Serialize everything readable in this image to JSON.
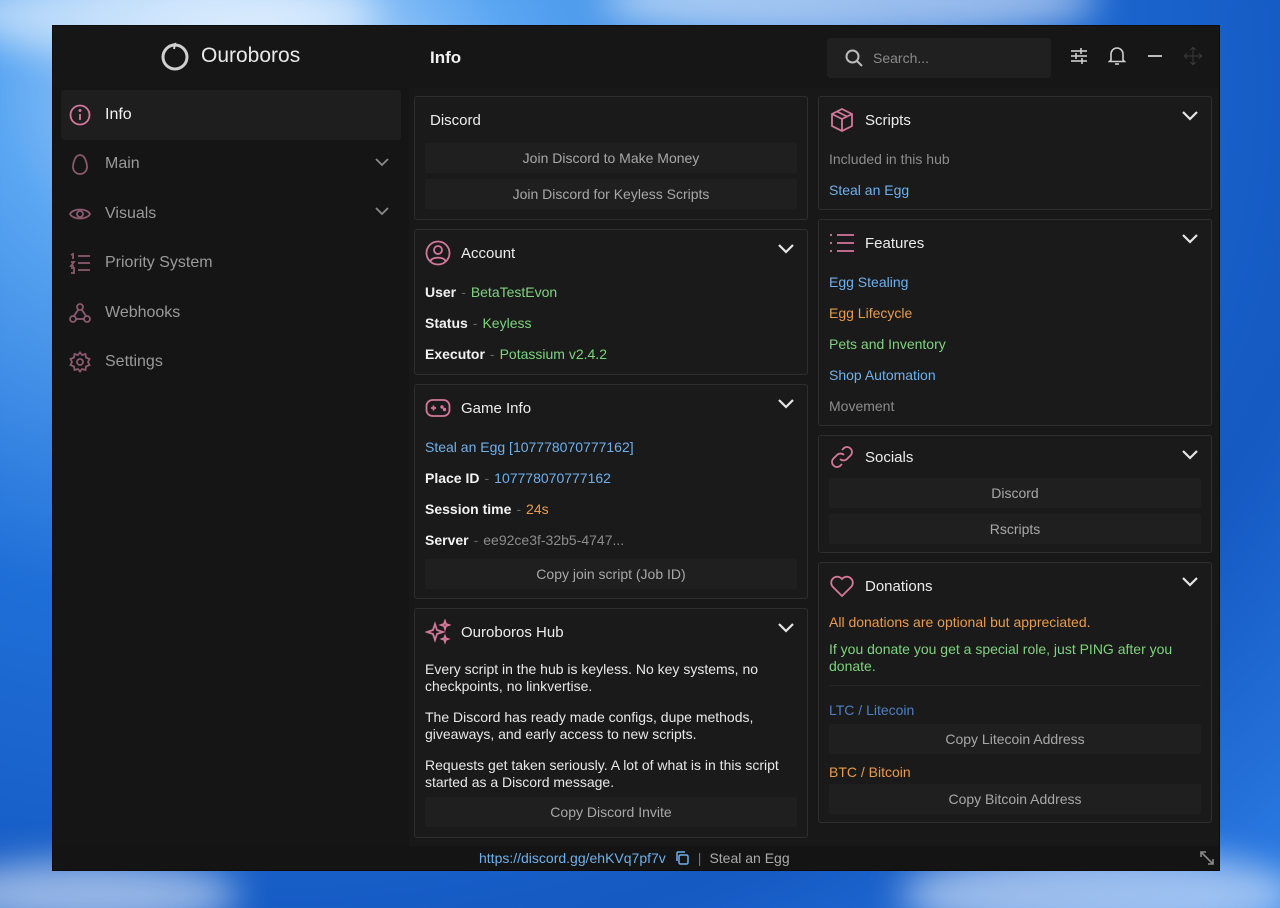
{
  "app": {
    "name": "Ouroboros",
    "page_title": "Info"
  },
  "search": {
    "placeholder": "Search..."
  },
  "top_icons": [
    "sliders-icon",
    "bell-icon",
    "minimize-icon",
    "move-icon"
  ],
  "sidebar": {
    "items": [
      {
        "label": "Info",
        "icon": "info-icon",
        "active": true
      },
      {
        "label": "Main",
        "icon": "egg-icon",
        "expandable": true
      },
      {
        "label": "Visuals",
        "icon": "eye-icon",
        "expandable": true
      },
      {
        "label": "Priority System",
        "icon": "list-ordered-icon"
      },
      {
        "label": "Webhooks",
        "icon": "webhook-icon"
      },
      {
        "label": "Settings",
        "icon": "gear-icon"
      }
    ]
  },
  "discord_card": {
    "title": "Discord",
    "buttons": [
      "Join Discord to Make Money",
      "Join Discord for Keyless Scripts"
    ]
  },
  "account": {
    "title": "Account",
    "rows": [
      {
        "key": "User",
        "value": "BetaTestEvon"
      },
      {
        "key": "Status",
        "value": "Keyless"
      },
      {
        "key": "Executor",
        "value": "Potassium v2.4.2"
      }
    ]
  },
  "game_info": {
    "title": "Game Info",
    "game_link": "Steal an Egg [107778070777162]",
    "rows": [
      {
        "key": "Place ID",
        "value": "107778070777162"
      },
      {
        "key": "Session time",
        "value": "24s"
      },
      {
        "key": "Server",
        "value": "ee92ce3f-32b5-4747..."
      }
    ],
    "button": "Copy join script (Job ID)"
  },
  "hub": {
    "title": "Ouroboros Hub",
    "paragraphs": [
      "Every script in the hub is keyless. No key systems, no checkpoints, no linkvertise.",
      "The Discord has ready made configs, dupe methods, giveaways, and early access to new scripts.",
      "Requests get taken seriously. A lot of what is in this script started as a Discord message."
    ],
    "button": "Copy Discord Invite"
  },
  "scripts": {
    "title": "Scripts",
    "subtitle": "Included in this hub",
    "items": [
      "Steal an Egg"
    ]
  },
  "features": {
    "title": "Features",
    "items": [
      "Egg Stealing",
      "Egg Lifecycle",
      "Pets and Inventory",
      "Shop Automation",
      "Movement"
    ]
  },
  "socials": {
    "title": "Socials",
    "buttons": [
      "Discord",
      "Rscripts"
    ]
  },
  "donations": {
    "title": "Donations",
    "note_optional": "All donations are optional but appreciated.",
    "note_role": "If you donate you get a special role, just PING after you donate.",
    "ltc_label": "LTC / Litecoin",
    "ltc_button": "Copy Litecoin Address",
    "btc_label": "BTC / Bitcoin",
    "btc_button": "Copy Bitcoin Address"
  },
  "statusbar": {
    "link": "https://discord.gg/ehKVq7pf7v",
    "sep": "|",
    "game": "Steal an Egg"
  },
  "colors": {
    "accent_pink": "#d4789a",
    "green": "#7ed37e",
    "blue": "#6fb0ec",
    "orange": "#e89a4e",
    "gray": "#8c8c8c"
  }
}
